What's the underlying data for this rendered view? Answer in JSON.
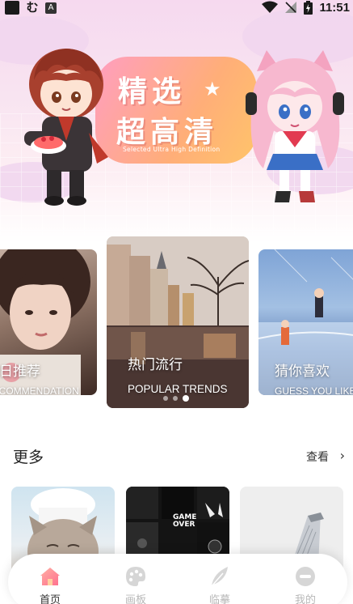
{
  "status_bar": {
    "time": "11:51",
    "left_icons": [
      "app-icon",
      "notification-glyph-icon",
      "a-badge-icon"
    ],
    "right_icons": [
      "wifi-icon",
      "no-signal-icon",
      "battery-charging-icon"
    ],
    "left_glyph": "む",
    "a_badge": "A"
  },
  "hero": {
    "title_line1": "精选",
    "title_line2": "超高清",
    "subtitle": "Selected Ultra High Definition",
    "star": "★"
  },
  "carousel": {
    "cards": [
      {
        "title": "今日推荐",
        "subtitle": "RECOMMENDATION"
      },
      {
        "title": "热门流行",
        "subtitle": "POPULAR TRENDS"
      },
      {
        "title": "猜你喜欢",
        "subtitle": "GUESS YOU LIKE"
      }
    ],
    "dots": 3,
    "active_dot": 2
  },
  "more": {
    "title": "更多",
    "link": "查看",
    "chevron": "›",
    "thumb_text": "GAME OVER"
  },
  "bottom_nav": {
    "items": [
      {
        "label": "首页",
        "icon": "home-icon",
        "active": true
      },
      {
        "label": "画板",
        "icon": "palette-icon",
        "active": false
      },
      {
        "label": "临摹",
        "icon": "feather-icon",
        "active": false
      },
      {
        "label": "我的",
        "icon": "profile-icon",
        "active": false
      }
    ]
  },
  "colors": {
    "hero_gradient_top": "#f6d9ef",
    "title_blob_left": "#ff9ec0",
    "title_blob_right": "#ffc46a",
    "nav_active": "#333333",
    "nav_inactive": "#b8b8b8",
    "home_icon": "#ff8a8a"
  }
}
